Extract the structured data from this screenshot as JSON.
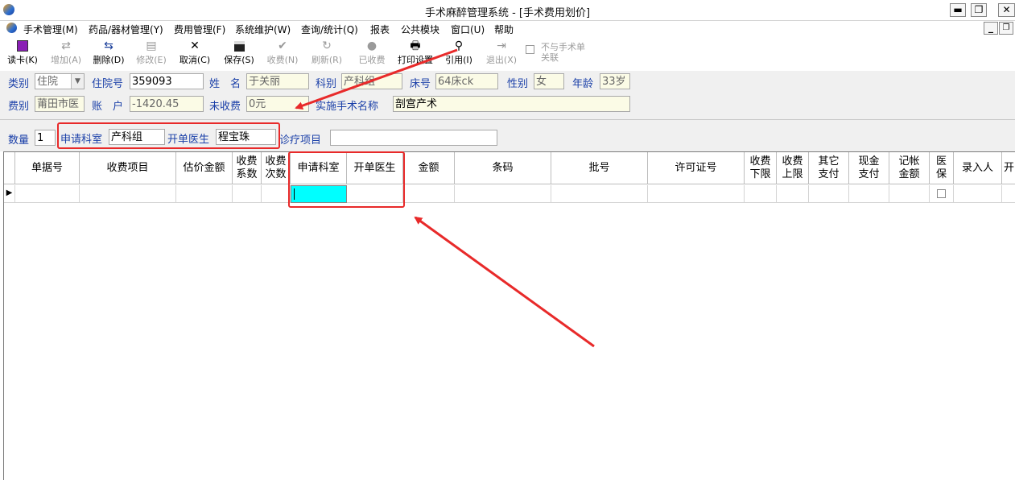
{
  "window": {
    "title": "手术麻醉管理系统 - [手术费用划价]",
    "min_btn": "▬",
    "restore_btn": "❐",
    "close_btn": "✕"
  },
  "menu": [
    "手术管理(M)",
    "药品/器材管理(Y)",
    "费用管理(F)",
    "系统维护(W)",
    "查询/统计(Q)",
    "报表",
    "公共模块",
    "窗口(U)",
    "帮助"
  ],
  "child_window": {
    "min_btn": "_",
    "restore_btn": "❐"
  },
  "toolbar": {
    "read_card": "读卡(K)",
    "add": "增加(A)",
    "delete": "删除(D)",
    "edit": "修改(E)",
    "cancel": "取消(C)",
    "save": "保存(S)",
    "charge": "收费(N)",
    "refresh": "刷新(R)",
    "charged": "已收费",
    "print_setup": "打印设置",
    "cite": "引用(I)",
    "exit": "退出(X)",
    "unlink_line1": "不与手术单",
    "unlink_line2": "关联"
  },
  "patient": {
    "category_label": "类别",
    "category_value": "住院",
    "admission_label": "住院号",
    "admission_value": "359093",
    "name_label": "姓　名",
    "name_value": "于关丽",
    "dept_label": "科别",
    "dept_value": "产科组",
    "bed_label": "床号",
    "bed_value": "64床ck",
    "sex_label": "性别",
    "sex_value": "女",
    "age_label": "年龄",
    "age_value": "33岁",
    "fee_type_label": "费别",
    "fee_type_value": "莆田市医",
    "account_label": "账　户",
    "account_value": "-1420.45",
    "uncharged_label": "未收费",
    "uncharged_value": "0元",
    "surgery_label": "实施手术名称",
    "surgery_value": "剖宫产术"
  },
  "entry": {
    "qty_label": "数量",
    "qty_value": "1",
    "apply_dept_label": "申请科室",
    "apply_dept_value": "产科组",
    "doctor_label": "开单医生",
    "doctor_value": "程宝珠",
    "item_label": "诊疗项目",
    "item_value": ""
  },
  "grid": {
    "columns": [
      "单据号",
      "收费项目",
      "估价金额",
      "收费\n系数",
      "收费\n次数",
      "申请科室",
      "开单医生",
      "金额",
      "条码",
      "批号",
      "许可证号",
      "收费\n下限",
      "收费\n上限",
      "其它\n支付",
      "现金\n支付",
      "记帐\n金额",
      "医\n保",
      "录入人",
      "开"
    ],
    "row_indicator": "▶"
  },
  "colors": {
    "label_blue": "#1a3fa8",
    "highlight_cell": "#00ffff",
    "annotation_red": "#e82a2a",
    "readonly_field": "#fbfbe6"
  }
}
